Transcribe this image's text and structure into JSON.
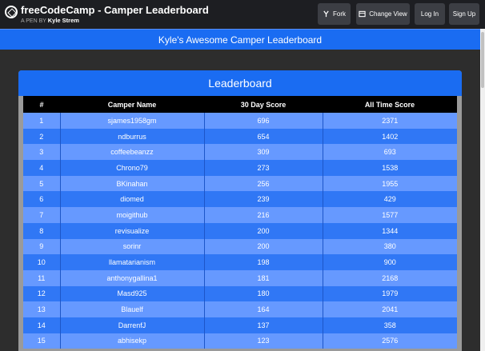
{
  "codepen": {
    "title": "freeCodeCamp - Camper Leaderboard",
    "by_prefix": "A PEN BY",
    "author": "Kyle Strem",
    "buttons": {
      "fork": "Fork",
      "change_view": "Change View",
      "login": "Log In",
      "signup": "Sign Up"
    }
  },
  "banner": {
    "title": "Kyle's Awesome Camper Leaderboard"
  },
  "leaderboard": {
    "title": "Leaderboard",
    "columns": [
      "#",
      "Camper Name",
      "30 Day Score",
      "All Time Score"
    ],
    "rows": [
      [
        "1",
        "sjames1958gm",
        "696",
        "2371"
      ],
      [
        "2",
        "ndburrus",
        "654",
        "1402"
      ],
      [
        "3",
        "coffeebeanzz",
        "309",
        "693"
      ],
      [
        "4",
        "Chrono79",
        "273",
        "1538"
      ],
      [
        "5",
        "BKinahan",
        "256",
        "1955"
      ],
      [
        "6",
        "diomed",
        "239",
        "429"
      ],
      [
        "7",
        "moigithub",
        "216",
        "1577"
      ],
      [
        "8",
        "revisualize",
        "200",
        "1344"
      ],
      [
        "9",
        "sorinr",
        "200",
        "380"
      ],
      [
        "10",
        "llamatarianism",
        "198",
        "900"
      ],
      [
        "11",
        "anthonygallina1",
        "181",
        "2168"
      ],
      [
        "12",
        "Masd925",
        "180",
        "1979"
      ],
      [
        "13",
        "Blauelf",
        "164",
        "2041"
      ],
      [
        "14",
        "DarrenfJ",
        "137",
        "358"
      ],
      [
        "15",
        "abhisekp",
        "123",
        "2576"
      ]
    ]
  },
  "colors": {
    "header_blue": "#1a6cf2",
    "row_odd": "#6699ff",
    "row_even": "#3077f5",
    "topbar": "#1d1e22"
  },
  "icons": {
    "logo": "codepen-logo-icon",
    "fork": "fork-icon",
    "change_view": "layout-icon"
  }
}
